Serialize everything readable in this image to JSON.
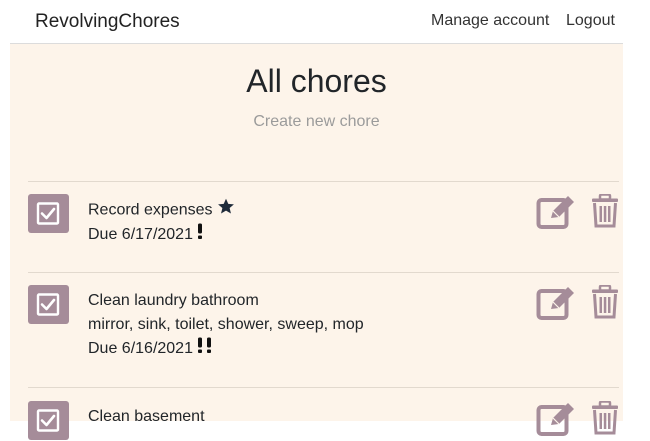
{
  "navbar": {
    "brand": "RevolvingChores",
    "manage_account": "Manage account",
    "logout": "Logout"
  },
  "main": {
    "title": "All chores",
    "create_link": "Create new chore"
  },
  "chores": [
    {
      "name": "Record expenses",
      "notes": "",
      "due": "Due 6/17/2021",
      "starred": true,
      "urgency": 1
    },
    {
      "name": "Clean laundry bathroom",
      "notes": "mirror, sink, toilet, shower, sweep, mop",
      "due": "Due 6/16/2021",
      "starred": false,
      "urgency": 2
    },
    {
      "name": "Clean basement",
      "notes": "",
      "due": "",
      "starred": false,
      "urgency": 0
    }
  ],
  "icons": {
    "complete": "check-square-icon",
    "star": "star-icon",
    "urgency": "exclamation-icon",
    "edit": "edit-icon",
    "delete": "trash-icon"
  },
  "colors": {
    "page_background": "#fdf4ea",
    "accent": "#a58c99",
    "muted_text": "#9b9b9b"
  }
}
